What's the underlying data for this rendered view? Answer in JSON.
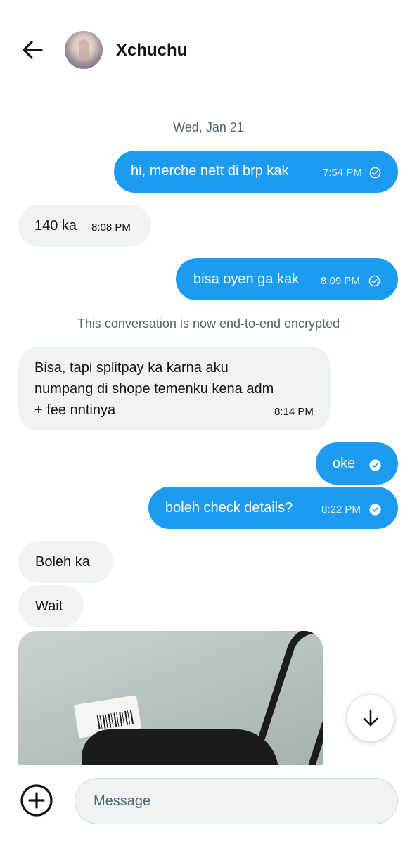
{
  "header": {
    "contact_name": "Xchuchu",
    "back_icon": "arrow-left-icon",
    "avatar_icon": "avatar"
  },
  "conversation": {
    "date_separator": "Wed, Jan 21",
    "system_note": "This conversation is now end-to-end encrypted",
    "messages": [
      {
        "direction": "out",
        "text": "hi, merche nett di brp kak",
        "time": "7:54 PM",
        "status": "sent"
      },
      {
        "direction": "in",
        "text": "140 ka",
        "time": "8:08 PM"
      },
      {
        "direction": "out",
        "text": "bisa oyen ga kak",
        "time": "8:09 PM",
        "status": "sent"
      },
      {
        "direction": "in",
        "lines": [
          "Bisa, tapi splitpay ka karna aku",
          "numpang di shope temenku kena adm",
          "+ fee nntinya"
        ],
        "time": "8:14 PM"
      },
      {
        "direction": "out",
        "text": "oke",
        "status": "read"
      },
      {
        "direction": "out",
        "text": "boleh check details?",
        "time": "8:22 PM",
        "status": "read"
      },
      {
        "direction": "in",
        "text": "Boleh ka"
      },
      {
        "direction": "in",
        "text": "Wait"
      },
      {
        "direction": "in",
        "type": "image"
      }
    ]
  },
  "composer": {
    "placeholder": "Message",
    "add_icon": "plus-circle-icon"
  },
  "scroll_button_icon": "arrow-down-icon",
  "colors": {
    "outgoing_bubble": "#1d9bf0",
    "incoming_bubble": "#eff3f4",
    "muted_text": "#536471"
  }
}
